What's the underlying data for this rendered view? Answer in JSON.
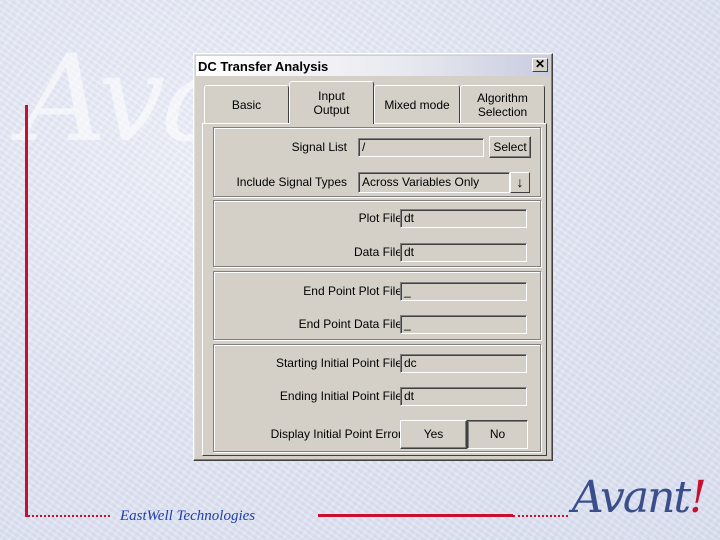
{
  "dialog": {
    "title": "DC Transfer Analysis",
    "close_icon": "close-icon",
    "tabs": [
      {
        "label": "Basic"
      },
      {
        "label": "Input\nOutput"
      },
      {
        "label": "Mixed mode"
      },
      {
        "label": "Algorithm\nSelection"
      }
    ],
    "active_tab": "Input Output",
    "signal": {
      "list_label": "Signal List",
      "list_value": "/",
      "select_button": "Select",
      "types_label": "Include Signal Types",
      "types_value": "Across Variables Only",
      "dropdown_icon": "arrow-down-icon"
    },
    "plot": {
      "plot_file_label": "Plot File",
      "plot_file_value": "dt",
      "data_file_label": "Data File",
      "data_file_value": "dt"
    },
    "endpoint": {
      "plot_label": "End Point Plot File",
      "plot_value": "_",
      "data_label": "End Point Data File",
      "data_value": "_"
    },
    "initial": {
      "start_label": "Starting Initial Point File",
      "start_value": "dc",
      "end_label": "Ending Initial Point File",
      "end_value": "dt",
      "error_label": "Display Initial Point Error",
      "yes_label": "Yes",
      "no_label": "No",
      "selected": "No"
    }
  },
  "footer": {
    "company": "EastWell Technologies",
    "logo_text": "Avant",
    "logo_accent": "!"
  },
  "watermark": {
    "text": "Avant"
  },
  "colors": {
    "accent_red": "#c8102e",
    "footer_blue": "#1f3fa8",
    "dialog_gray": "#d4d0c8"
  }
}
